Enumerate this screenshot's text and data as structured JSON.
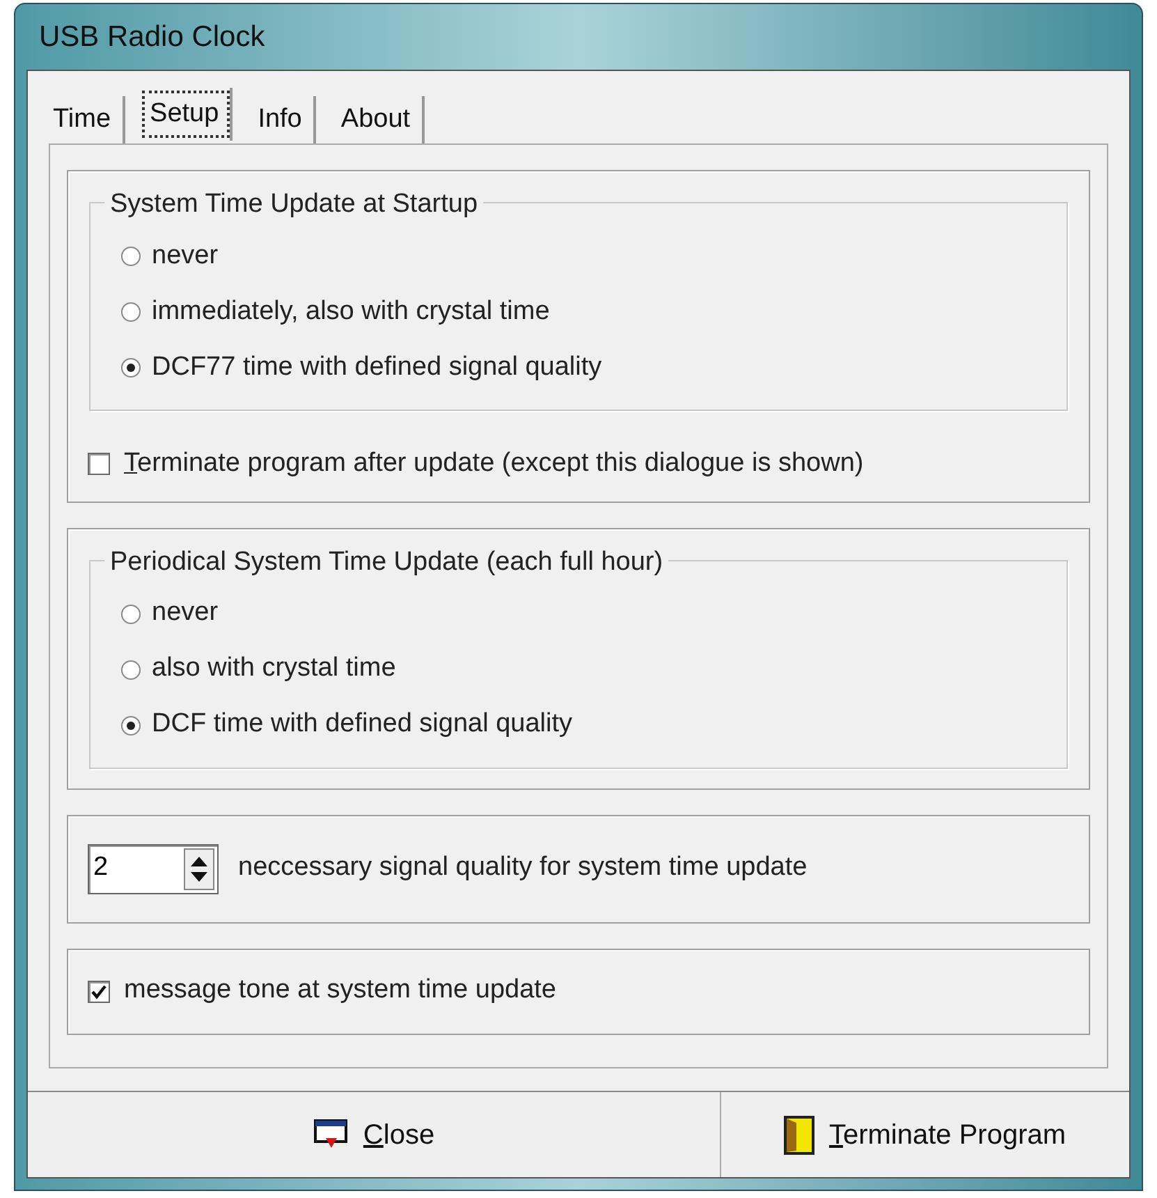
{
  "window": {
    "title": "USB Radio Clock"
  },
  "tabs": [
    {
      "label": "Time",
      "selected": false
    },
    {
      "label": "Setup",
      "selected": true
    },
    {
      "label": "Info",
      "selected": false
    },
    {
      "label": "About",
      "selected": false
    }
  ],
  "startup_update": {
    "title": "System Time Update at Startup",
    "options": [
      {
        "label": "never",
        "selected": false
      },
      {
        "label": "immediately, also with crystal time",
        "selected": false
      },
      {
        "label": "DCF77 time with defined signal quality",
        "selected": true
      }
    ]
  },
  "terminate_after_update": {
    "label": "Terminate program after update (except this dialogue is shown)",
    "checked": false,
    "mnemonic": true
  },
  "periodical_update": {
    "title": "Periodical System Time Update (each full hour)",
    "options": [
      {
        "label": "never",
        "selected": false
      },
      {
        "label": "also with crystal time",
        "selected": false
      },
      {
        "label": "DCF time with defined signal quality",
        "selected": true
      }
    ]
  },
  "signal_quality": {
    "value": "2",
    "label": "neccessary signal quality for system time update"
  },
  "message_tone": {
    "label": "message tone at system time update",
    "checked": true
  },
  "buttons": [
    {
      "label": "Close",
      "kind": "close",
      "mnemonic": true
    },
    {
      "label": "Terminate Program",
      "kind": "terminate",
      "mnemonic": true
    }
  ]
}
